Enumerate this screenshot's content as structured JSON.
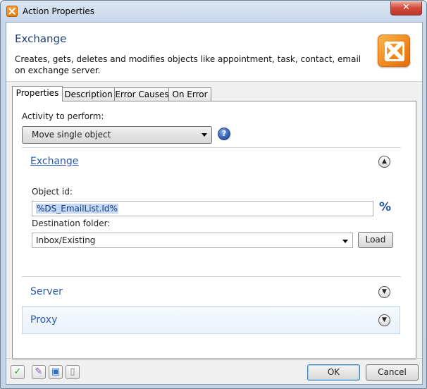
{
  "window": {
    "title": "Action Properties",
    "close_glyph": "✕"
  },
  "header": {
    "title": "Exchange",
    "description": "Creates, gets, deletes and modifies objects like appointment, task, contact, email on exchange server.",
    "logo_icon": "exchange-logo-icon"
  },
  "tabs": [
    {
      "label": "Properties",
      "active": true
    },
    {
      "label": "Description",
      "active": false
    },
    {
      "label": "Error Causes",
      "active": false
    },
    {
      "label": "On Error",
      "active": false
    }
  ],
  "properties": {
    "activity_label": "Activity to perform:",
    "activity_value": "Move single object",
    "help_glyph": "?",
    "sections": {
      "exchange": {
        "title": "Exchange",
        "expanded": true,
        "object_id_label": "Object id:",
        "object_id_value": "%DS_EmailList.Id%",
        "variable_glyph": "%",
        "destination_label": "Destination folder:",
        "destination_value": "Inbox/Existing",
        "load_label": "Load"
      },
      "server": {
        "title": "Server",
        "expanded": false
      },
      "proxy": {
        "title": "Proxy",
        "expanded": false
      }
    }
  },
  "footer": {
    "icons": [
      "checkmark-icon",
      "edit-icon",
      "apply-icon",
      "new-document-icon"
    ],
    "ok_label": "OK",
    "cancel_label": "Cancel"
  },
  "colors": {
    "accent": "#2b59a8",
    "header_title": "#1e3f7a",
    "logo": "#f08619"
  }
}
